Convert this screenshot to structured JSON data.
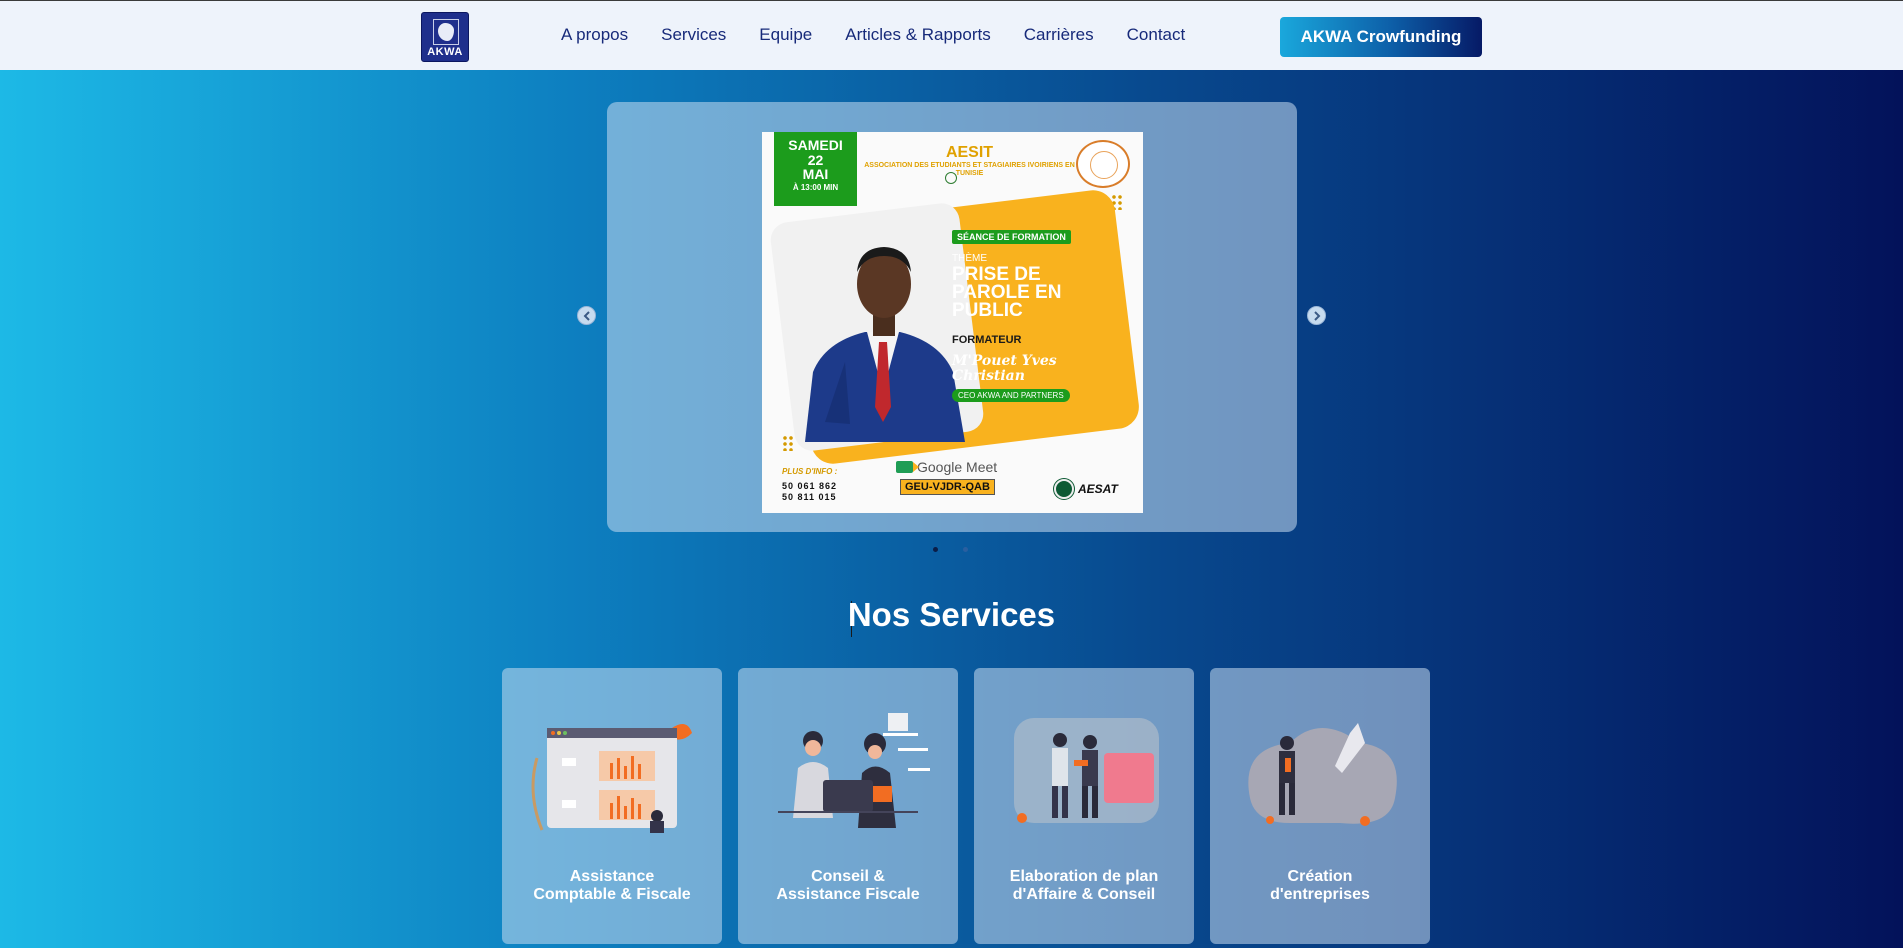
{
  "header": {
    "logo_text": "AKWA",
    "nav": [
      "A propos",
      "Services",
      "Equipe",
      "Articles & Rapports",
      "Carrières",
      "Contact"
    ],
    "cta_label": "AKWA Crowfunding"
  },
  "carousel": {
    "slide": {
      "date": [
        "SAMEDI",
        "22",
        "MAI",
        "À 13:00 MIN"
      ],
      "org_name": "AESIT",
      "org_full": "ASSOCIATION DES ETUDIANTS ET STAGIAIRES IVOIRIENS EN TUNISIE",
      "seance": "SÉANCE DE FORMATION",
      "theme_label": "THÈME",
      "theme_title": "PRISE DE PAROLE EN PUBLIC",
      "formateur_label": "FORMATEUR",
      "trainer_name": "M'Pouet Yves Christian",
      "trainer_role": "CEO AKWA AND PARTNERS",
      "info_label": "PLUS D'INFO :",
      "phone_1": "50 061 862",
      "phone_2": "50 811 015",
      "platform": "Google Meet",
      "meet_code": "GEU-VJDR-QAB",
      "partner": "AESAT"
    },
    "slide_count": 2,
    "active_index": 0
  },
  "services": {
    "title": "Nos Services",
    "items": [
      {
        "line1": "Assistance",
        "line2": "Comptable & Fiscale",
        "icon": "accounting-illustration"
      },
      {
        "line1": "Conseil &",
        "line2": "Assistance Fiscale",
        "icon": "consulting-illustration"
      },
      {
        "line1": "Elaboration de plan",
        "line2": "d'Affaire & Conseil",
        "icon": "business-plan-illustration"
      },
      {
        "line1": "Création",
        "line2": "d'entreprises",
        "icon": "company-creation-illustration"
      }
    ]
  },
  "colors": {
    "nav_text": "#172a7a",
    "header_bg": "#eef3fb",
    "accent_orange": "#f9b21e",
    "accent_green": "#1c9c1c",
    "gradient_start": "#1db9e6",
    "gradient_end": "#03125a"
  }
}
